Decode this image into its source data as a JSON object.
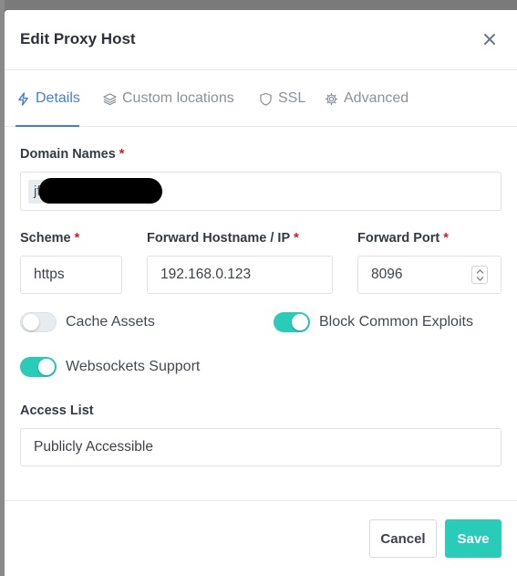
{
  "modal": {
    "title": "Edit Proxy Host"
  },
  "tabs": [
    {
      "label": "Details",
      "icon": "bolt-icon",
      "active": true
    },
    {
      "label": "Custom locations",
      "icon": "layers-icon",
      "active": false
    },
    {
      "label": "SSL",
      "icon": "shield-icon",
      "active": false
    },
    {
      "label": "Advanced",
      "icon": "gear-icon",
      "active": false
    }
  ],
  "form": {
    "domain_names": {
      "label": "Domain Names",
      "required": "*",
      "chip_text": "jf"
    },
    "scheme": {
      "label": "Scheme",
      "required": "*",
      "value": "https"
    },
    "forward_host": {
      "label": "Forward Hostname / IP",
      "required": "*",
      "value": "192.168.0.123"
    },
    "forward_port": {
      "label": "Forward Port",
      "required": "*",
      "value": "8096"
    },
    "cache_assets": {
      "label": "Cache Assets",
      "enabled": false
    },
    "block_exploits": {
      "label": "Block Common Exploits",
      "enabled": true
    },
    "websockets": {
      "label": "Websockets Support",
      "enabled": true
    },
    "access_list": {
      "label": "Access List",
      "value": "Publicly Accessible"
    }
  },
  "footer": {
    "cancel_label": "Cancel",
    "save_label": "Save"
  },
  "colors": {
    "accent": "#2bcbba",
    "active_tab": "#467fcf",
    "required": "#cd201f"
  }
}
